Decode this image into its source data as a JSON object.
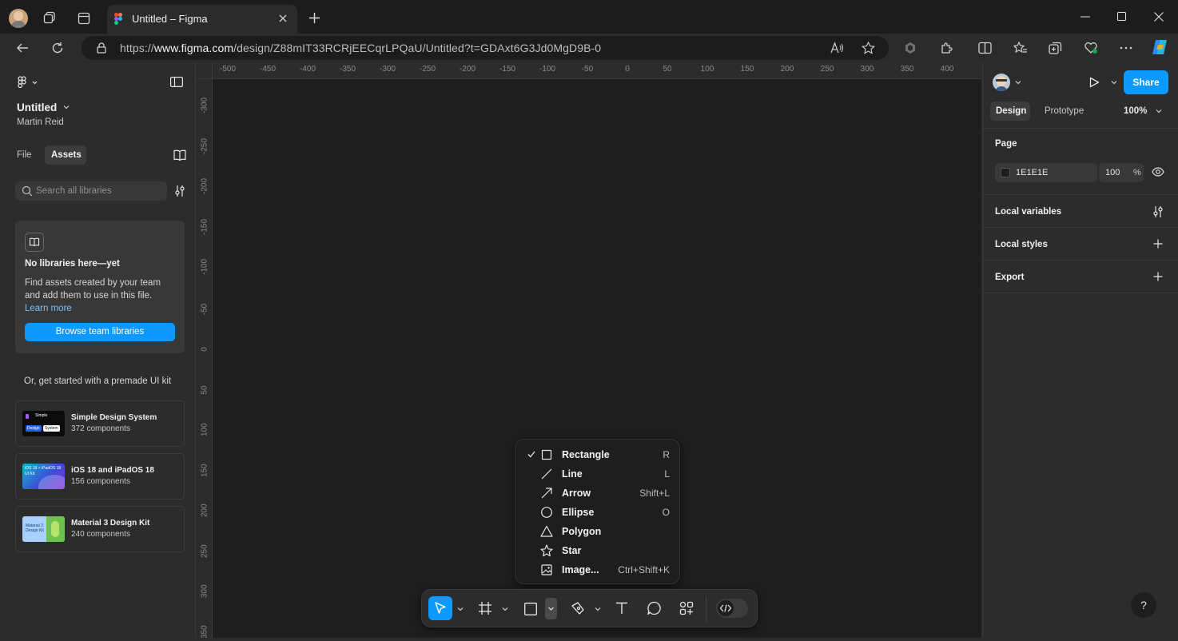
{
  "browser": {
    "tab_title": "Untitled – Figma",
    "url_prefix": "https://",
    "url_domain": "www.figma.com",
    "url_rest": "/design/Z88mIT33RCRjEECqrLPQaU/Untitled?t=GDAxt6G3Jd0MgD9B-0"
  },
  "file": {
    "name": "Untitled",
    "owner": "Martin Reid"
  },
  "left_tabs": {
    "file": "File",
    "assets": "Assets"
  },
  "search": {
    "placeholder": "Search all libraries"
  },
  "empty_libraries": {
    "heading": "No libraries here—yet",
    "body_line1": "Find assets created by your team",
    "body_line2": "and add them to use in this file.",
    "learn_more": "Learn more",
    "browse_button": "Browse team libraries"
  },
  "ui_kits": {
    "intro": "Or, get started with a premade UI kit",
    "items": [
      {
        "name": "Simple Design System",
        "count": "372 components",
        "thumb_text1": "Simple",
        "thumb_text2": "Design",
        "thumb_text3": "System"
      },
      {
        "name": "iOS 18 and iPadOS 18",
        "count": "156 components",
        "thumb_text1": "iOS 18 + iPadOS 18",
        "thumb_text2": "UI Kit"
      },
      {
        "name": "Material 3 Design Kit",
        "count": "240 components",
        "thumb_text1": "Material 3",
        "thumb_text2": "Design Kit"
      }
    ]
  },
  "rulers": {
    "horizontal": [
      "-500",
      "-450",
      "-400",
      "-350",
      "-300",
      "-250",
      "-200",
      "-150",
      "-100",
      "-50",
      "0",
      "50",
      "100",
      "150",
      "200",
      "250",
      "300",
      "350",
      "400"
    ],
    "vertical": [
      "-300",
      "-250",
      "-200",
      "-150",
      "-100",
      "-50",
      "0",
      "50",
      "100",
      "150",
      "200",
      "250",
      "300",
      "350"
    ]
  },
  "shape_menu": {
    "items": [
      {
        "label": "Rectangle",
        "shortcut": "R",
        "checked": true,
        "icon": "rectangle-icon"
      },
      {
        "label": "Line",
        "shortcut": "L",
        "checked": false,
        "icon": "line-icon"
      },
      {
        "label": "Arrow",
        "shortcut": "Shift+L",
        "checked": false,
        "icon": "arrow-icon"
      },
      {
        "label": "Ellipse",
        "shortcut": "O",
        "checked": false,
        "icon": "ellipse-icon"
      },
      {
        "label": "Polygon",
        "shortcut": "",
        "checked": false,
        "icon": "polygon-icon"
      },
      {
        "label": "Star",
        "shortcut": "",
        "checked": false,
        "icon": "star-icon"
      },
      {
        "label": "Image...",
        "shortcut": "Ctrl+Shift+K",
        "checked": false,
        "icon": "image-icon"
      }
    ]
  },
  "right_panel": {
    "share_label": "Share",
    "tab_design": "Design",
    "tab_prototype": "Prototype",
    "zoom": "100%",
    "page_title": "Page",
    "page_color": "1E1E1E",
    "page_opacity": "100",
    "percent": "%",
    "local_variables": "Local variables",
    "local_styles": "Local styles",
    "export": "Export",
    "help": "?"
  },
  "colors": {
    "accent": "#0d99ff",
    "canvas": "#1e1e1e",
    "panel": "#2c2c2c"
  }
}
